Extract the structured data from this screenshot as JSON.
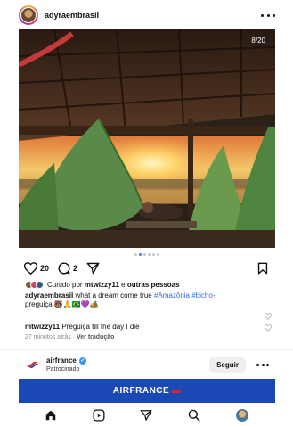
{
  "post": {
    "username": "adyraembrasil",
    "media_counter": "8/20",
    "pager": {
      "total": 6,
      "active": 1
    },
    "likes_count": "20",
    "comments_count": "2",
    "liked_by_prefix": "Curtido por ",
    "liked_by_user": "mtwizzy11",
    "liked_by_mid": " e ",
    "liked_by_others": "outras pessoas",
    "caption_user": "adyraembrasil",
    "caption_text": " what a dream come true ",
    "caption_tags": [
      "#Amazônia",
      "#bicho-"
    ],
    "caption_line2": "preguiça 🐻🙏🇧🇷💜🏕️",
    "comment_user": "mtwizzy11",
    "comment_text": " Preguiça till the day I die",
    "time_ago": "27 minutos atrás",
    "meta_separator": " · ",
    "see_translation": "Ver tradução"
  },
  "ad": {
    "name": "airfrance",
    "sponsored_label": "Patrocinado",
    "follow_label": "Seguir",
    "banner_text": "AIRFRANCE",
    "brand_color": "#1a49b5",
    "accent_color": "#d8232a"
  },
  "nav": {
    "items": [
      "home-icon",
      "reels-icon",
      "send-icon",
      "search-icon",
      "profile-avatar"
    ]
  },
  "colors": {
    "link": "#2f6fd6",
    "pager_active": "#3b82f6",
    "muted": "#8a8a8a"
  }
}
